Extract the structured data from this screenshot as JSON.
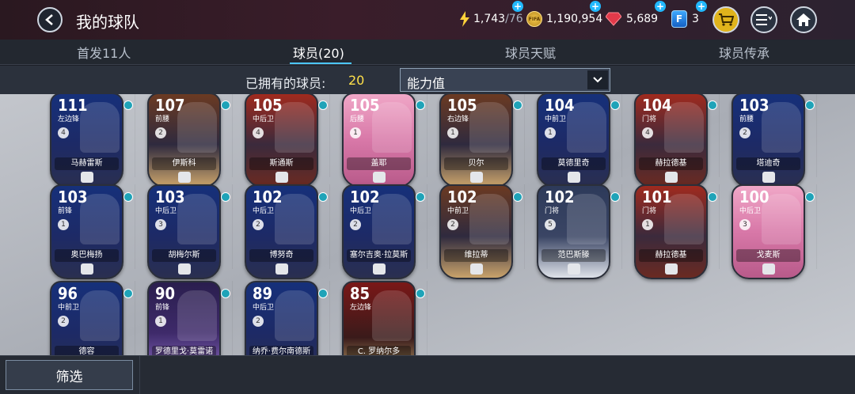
{
  "header": {
    "title": "我的球队",
    "energy": "1,743",
    "energy_max": "/76",
    "coins": "1,190,954",
    "coin_label": "FIFA",
    "gems": "5,689",
    "fifa_points": "3",
    "fifa_points_letter": "F",
    "plus": "+"
  },
  "tabs": [
    {
      "label": "首发11人"
    },
    {
      "label": "球员(20)"
    },
    {
      "label": "球员天赋"
    },
    {
      "label": "球员传承"
    }
  ],
  "filter": {
    "owned_label": "已拥有的球员:",
    "owned_count": "20",
    "sort_value": "能力值"
  },
  "players": [
    {
      "rating": "111",
      "pos": "左边锋",
      "name": "马赫雷斯",
      "style": "cobalt",
      "level": "4"
    },
    {
      "rating": "107",
      "pos": "前腰",
      "name": "伊斯科",
      "style": "gold",
      "level": "2"
    },
    {
      "rating": "105",
      "pos": "中后卫",
      "name": "斯通斯",
      "style": "red",
      "level": "4"
    },
    {
      "rating": "105",
      "pos": "后腰",
      "name": "盖耶",
      "style": "pink",
      "level": "1"
    },
    {
      "rating": "105",
      "pos": "右边锋",
      "name": "贝尔",
      "style": "gold",
      "level": "1"
    },
    {
      "rating": "104",
      "pos": "中前卫",
      "name": "莫德里奇",
      "style": "cobalt",
      "level": "1"
    },
    {
      "rating": "104",
      "pos": "门将",
      "name": "赫拉德基",
      "style": "red",
      "level": "4"
    },
    {
      "rating": "103",
      "pos": "前腰",
      "name": "塔迪奇",
      "style": "cobalt",
      "level": "2"
    },
    {
      "rating": "103",
      "pos": "前锋",
      "name": "奥巴梅扬",
      "style": "cobalt",
      "level": "1"
    },
    {
      "rating": "103",
      "pos": "中后卫",
      "name": "胡梅尔斯",
      "style": "cobalt",
      "level": "3"
    },
    {
      "rating": "102",
      "pos": "中后卫",
      "name": "博努奇",
      "style": "cobalt",
      "level": "2"
    },
    {
      "rating": "102",
      "pos": "中后卫",
      "name": "塞尔吉奥·拉莫斯",
      "style": "cobalt",
      "level": "2"
    },
    {
      "rating": "102",
      "pos": "中前卫",
      "name": "维拉蒂",
      "style": "gold",
      "level": "2"
    },
    {
      "rating": "102",
      "pos": "门将",
      "name": "范巴斯滕",
      "style": "silver",
      "level": "5"
    },
    {
      "rating": "101",
      "pos": "门将",
      "name": "赫拉德基",
      "style": "red",
      "level": "1"
    },
    {
      "rating": "100",
      "pos": "中后卫",
      "name": "戈麦斯",
      "style": "pink",
      "level": "3"
    },
    {
      "rating": "96",
      "pos": "中前卫",
      "name": "德容",
      "style": "cobalt",
      "level": "2"
    },
    {
      "rating": "90",
      "pos": "前锋",
      "name": "罗德里戈·莫雷诺",
      "style": "purple",
      "level": "1"
    },
    {
      "rating": "89",
      "pos": "中后卫",
      "name": "纳乔·费尔南德斯",
      "style": "cobalt",
      "level": "2"
    },
    {
      "rating": "85",
      "pos": "左边锋",
      "name": "C. 罗纳尔多",
      "style": "darkred",
      "level": ""
    }
  ],
  "bottom": {
    "filter_label": "筛选"
  },
  "colors": {
    "accent": "#4cc6ff",
    "count_highlight": "#ffe04a",
    "cart": "#e0b41c"
  }
}
